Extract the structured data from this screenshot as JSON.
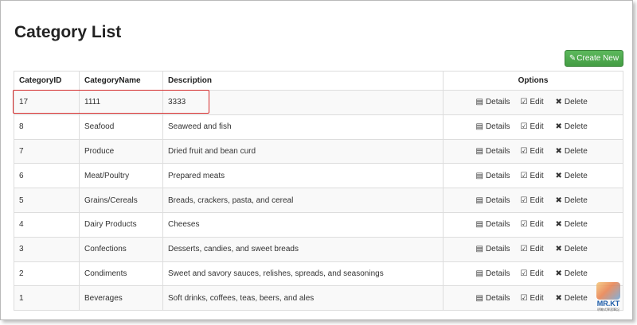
{
  "page": {
    "title": "Category List"
  },
  "toolbar": {
    "create_label": "Create New",
    "create_icon": "pencil-icon"
  },
  "table": {
    "headers": [
      "CategoryID",
      "CategoryName",
      "Description",
      "Options"
    ],
    "rows": [
      {
        "id": "17",
        "name": "1111",
        "description": "3333"
      },
      {
        "id": "8",
        "name": "Seafood",
        "description": "Seaweed and fish"
      },
      {
        "id": "7",
        "name": "Produce",
        "description": "Dried fruit and bean curd"
      },
      {
        "id": "6",
        "name": "Meat/Poultry",
        "description": "Prepared meats"
      },
      {
        "id": "5",
        "name": "Grains/Cereals",
        "description": "Breads, crackers, pasta, and cereal"
      },
      {
        "id": "4",
        "name": "Dairy Products",
        "description": "Cheeses"
      },
      {
        "id": "3",
        "name": "Confections",
        "description": "Desserts, candies, and sweet breads"
      },
      {
        "id": "2",
        "name": "Condiments",
        "description": "Sweet and savory sauces, relishes, spreads, and seasonings"
      },
      {
        "id": "1",
        "name": "Beverages",
        "description": "Soft drinks, coffees, teas, beers, and ales"
      }
    ],
    "row_actions": {
      "details_label": "Details",
      "details_icon": "list-alt-icon",
      "edit_label": "Edit",
      "edit_icon": "edit-icon",
      "delete_label": "Delete",
      "delete_icon": "remove-icon"
    }
  },
  "watermark": {
    "text": "MR.KT",
    "subtext": "明瞭式學習筆記"
  },
  "colors": {
    "create_button": "#5cb85c",
    "highlight_border": "#d42a2a",
    "stripe": "#f9f9f9"
  }
}
